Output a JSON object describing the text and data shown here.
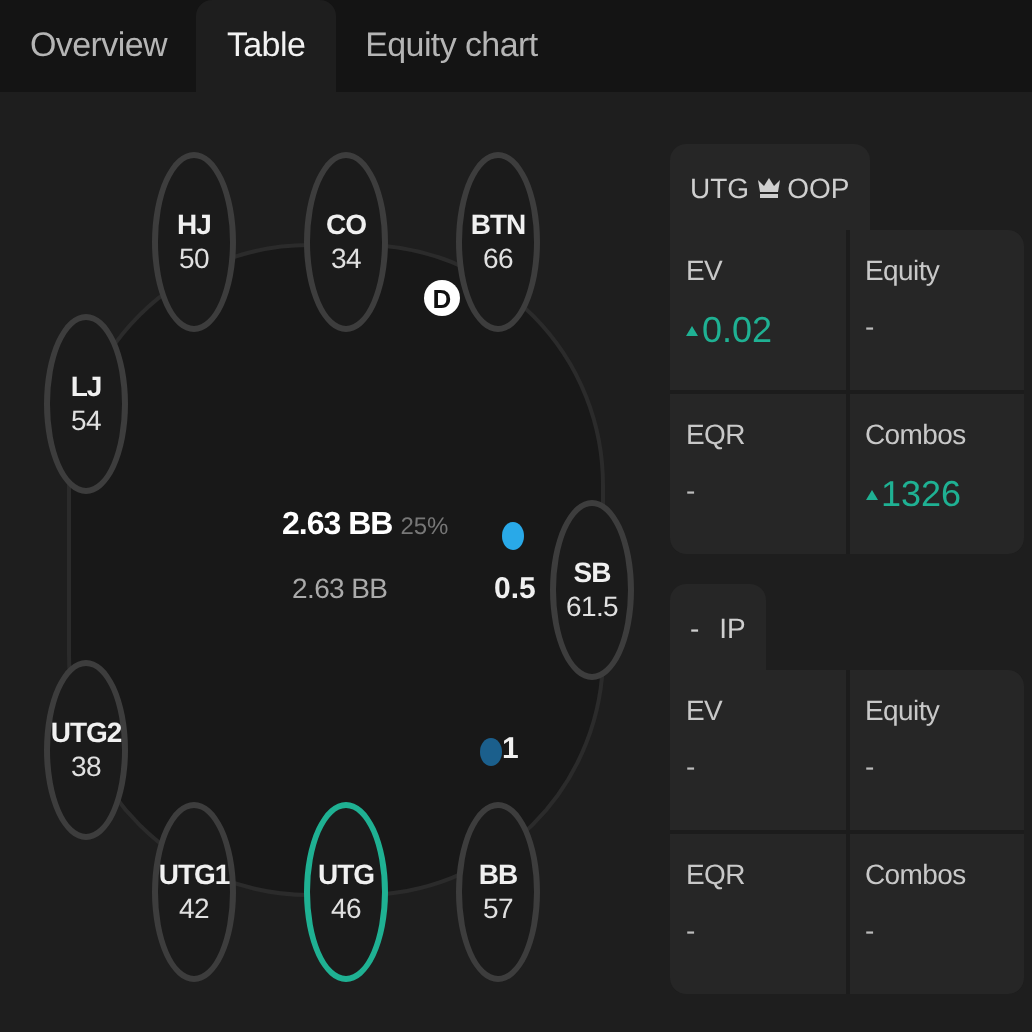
{
  "tabs": [
    {
      "label": "Overview",
      "selected": false
    },
    {
      "label": "Table",
      "selected": true
    },
    {
      "label": "Equity chart",
      "selected": false
    }
  ],
  "table": {
    "seats": [
      {
        "position": "HJ",
        "stack": "50",
        "selected": false
      },
      {
        "position": "CO",
        "stack": "34",
        "selected": false
      },
      {
        "position": "BTN",
        "stack": "66",
        "selected": false
      },
      {
        "position": "LJ",
        "stack": "54",
        "selected": false
      },
      {
        "position": "SB",
        "stack": "61.5",
        "selected": false
      },
      {
        "position": "UTG2",
        "stack": "38",
        "selected": false
      },
      {
        "position": "UTG1",
        "stack": "42",
        "selected": false
      },
      {
        "position": "UTG",
        "stack": "46",
        "selected": true
      },
      {
        "position": "BB",
        "stack": "57",
        "selected": false
      }
    ],
    "dealer": "D",
    "pot": {
      "amount": "2.63 BB",
      "percent": "25%",
      "total": "2.63 BB"
    },
    "bets": [
      {
        "amount": "0.5",
        "color": "#29a9e8"
      },
      {
        "amount": "1",
        "color": "#1b5f8c"
      }
    ]
  },
  "players": [
    {
      "title": "UTG",
      "crown": true,
      "role": "OOP",
      "stats": [
        {
          "label": "EV",
          "value": "0.02",
          "rising": true
        },
        {
          "label": "Equity",
          "value": "-",
          "rising": false
        },
        {
          "label": "EQR",
          "value": "-",
          "rising": false
        },
        {
          "label": "Combos",
          "value": "1326",
          "rising": true
        }
      ]
    },
    {
      "title": "-",
      "crown": false,
      "role": "IP",
      "stats": [
        {
          "label": "EV",
          "value": "-",
          "rising": false
        },
        {
          "label": "Equity",
          "value": "-",
          "rising": false
        },
        {
          "label": "EQR",
          "value": "-",
          "rising": false
        },
        {
          "label": "Combos",
          "value": "-",
          "rising": false
        }
      ]
    }
  ]
}
